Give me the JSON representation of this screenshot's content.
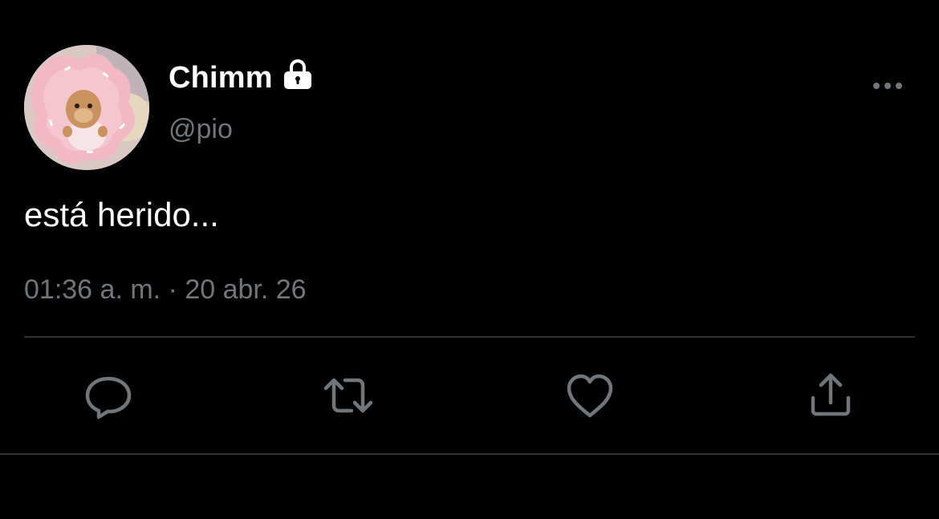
{
  "tweet": {
    "display_name": "Chimm",
    "handle": "@pio",
    "text": "está herido...",
    "time": "01:36 a. m.",
    "separator": "·",
    "date": "20 abr. 26"
  },
  "icons": {
    "avatar": "avatar-photo",
    "lock": "lock-icon",
    "more": "more-options-icon",
    "reply": "reply-icon",
    "retweet": "retweet-icon",
    "like": "heart-icon",
    "share": "share-icon"
  },
  "colors": {
    "background": "#000000",
    "primary_text": "#ffffff",
    "secondary_text": "#71767b",
    "divider": "#2f3336"
  }
}
